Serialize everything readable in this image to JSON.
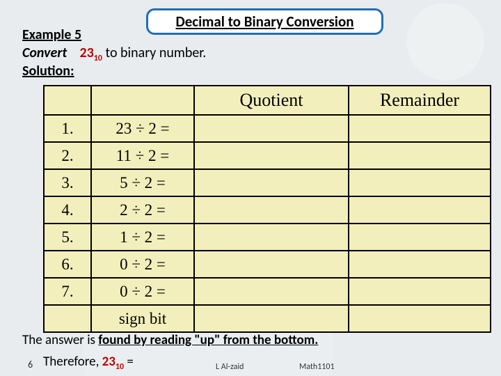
{
  "title": "Decimal to Binary Conversion",
  "example_label": "Example 5",
  "convert_word": "Convert",
  "convert_value": "23",
  "convert_subscript": "10",
  "convert_tail": " to binary  number.",
  "solution_label": "Solution:",
  "headers": {
    "c1": "",
    "c2": "",
    "c3": "Quotient",
    "c4": "Remainder"
  },
  "rows": [
    {
      "n": "1.",
      "expr": "23 ÷ 2 =",
      "q": "",
      "r": ""
    },
    {
      "n": "2.",
      "expr": "11 ÷ 2 =",
      "q": "",
      "r": ""
    },
    {
      "n": "3.",
      "expr": "5 ÷ 2 =",
      "q": "",
      "r": ""
    },
    {
      "n": "4.",
      "expr": "2 ÷ 2 =",
      "q": "",
      "r": ""
    },
    {
      "n": "5.",
      "expr": "1 ÷ 2 =",
      "q": "",
      "r": ""
    },
    {
      "n": "6.",
      "expr": "0 ÷ 2 =",
      "q": "",
      "r": ""
    },
    {
      "n": "7.",
      "expr": "0 ÷ 2 =",
      "q": "",
      "r": ""
    },
    {
      "n": "",
      "expr": "sign bit",
      "q": "",
      "r": ""
    }
  ],
  "answer_pre": "The answer is ",
  "answer_bold": "found by reading \"up\" from the bottom.",
  "therefore_pre": "Therefore, ",
  "therefore_value": "23",
  "therefore_sub": "10",
  "therefore_tail": " = ",
  "footer": {
    "page": "6",
    "author": "L Al-zaid",
    "course": "Math1101"
  }
}
